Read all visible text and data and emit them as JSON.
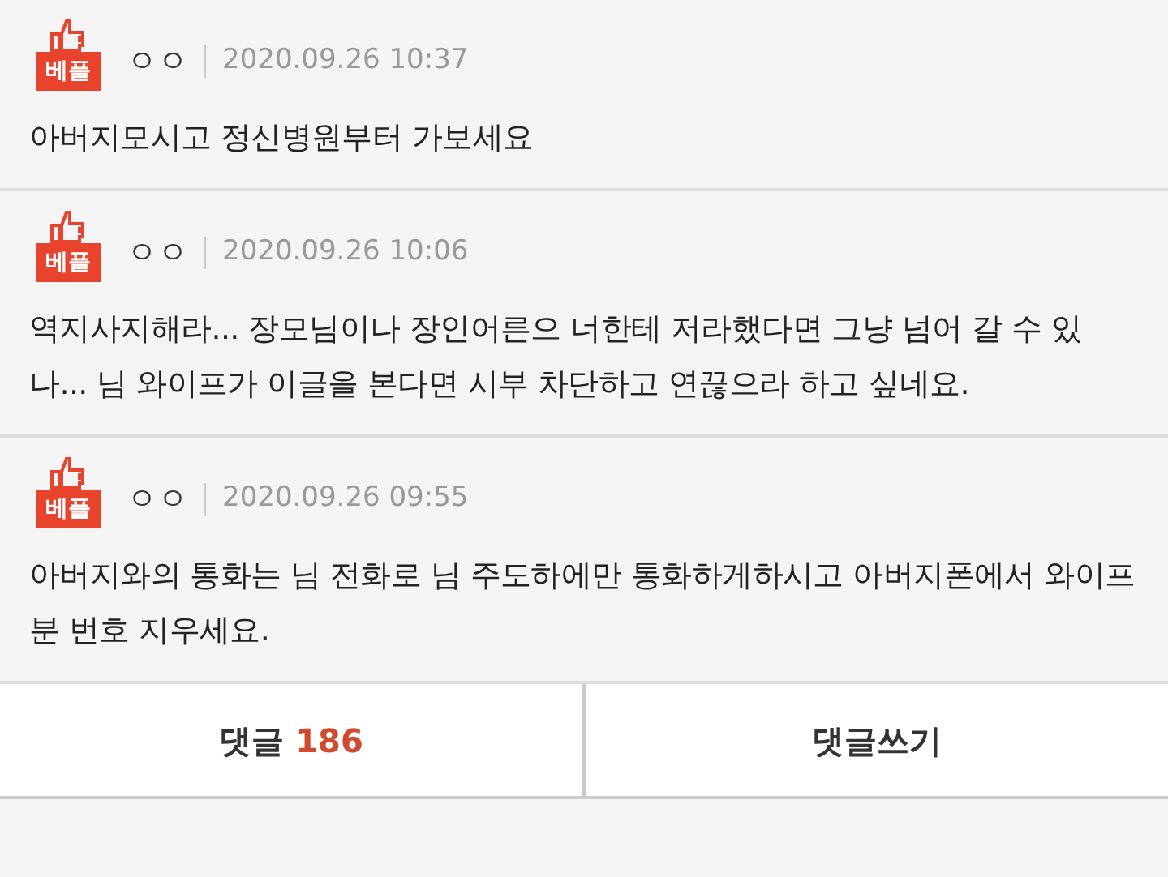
{
  "comments": [
    {
      "badge": "베플",
      "author": "ㅇㅇ",
      "time": "2020.09.26 10:37",
      "text": "아버지모시고 정신병원부터 가보세요"
    },
    {
      "badge": "베플",
      "author": "ㅇㅇ",
      "time": "2020.09.26 10:06",
      "text": "역지사지해라... 장모님이나 장인어른으 너한테 저라했다면 그냥 넘어 갈 수 있나... 님 와이프가 이글을 본다면 시부 차단하고 연끊으라 하고 싶네요."
    },
    {
      "badge": "베플",
      "author": "ㅇㅇ",
      "time": "2020.09.26 09:55",
      "text": "아버지와의 통화는 님 전화로 님 주도하에만 통화하게하시고 아버지폰에서 와이프분 번호 지우세요."
    }
  ],
  "footer": {
    "comments_label": "댓글",
    "comments_count": "186",
    "write_label": "댓글쓰기"
  }
}
